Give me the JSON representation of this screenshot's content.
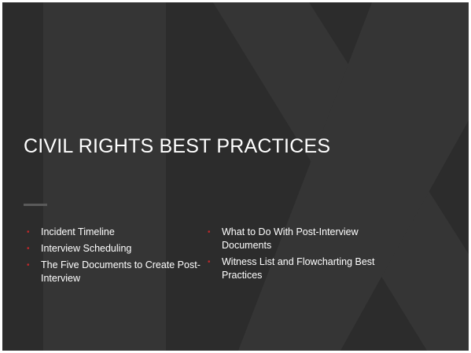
{
  "slide": {
    "title": "CIVIL RIGHTS BEST PRACTICES",
    "watermark_text": "IX",
    "bullet_color": "#c0282a",
    "background_color": "#2c2c2c",
    "left_column": [
      {
        "text": "Incident Timeline"
      },
      {
        "text": "Interview Scheduling"
      },
      {
        "text": "The Five Documents to Create Post-Interview"
      }
    ],
    "right_column": [
      {
        "text": "What to Do With Post-Interview Documents"
      },
      {
        "text": "Witness List and Flowcharting Best Practices"
      }
    ]
  }
}
